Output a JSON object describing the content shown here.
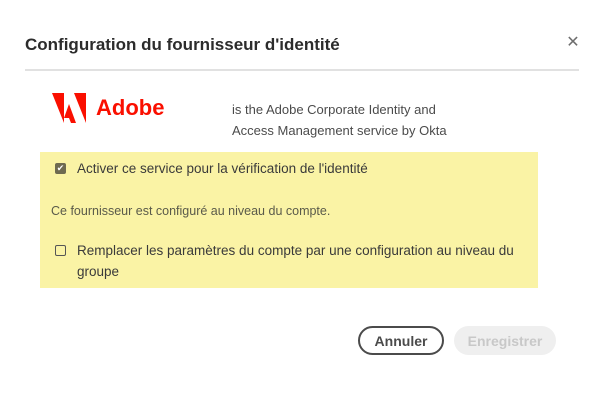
{
  "dialog": {
    "title": "Configuration du fournisseur d'identité",
    "close_icon": "close-icon"
  },
  "provider": {
    "logo_text": "Adobe",
    "brand_color": "#fa0f00",
    "description": "is the Adobe Corporate Identity and Access Management service by Okta"
  },
  "options": {
    "enable_label": "Activer ce service pour la vérification de l'identité",
    "enable_checked": true,
    "note": "Ce fournisseur est configuré au niveau du compte.",
    "override_label": "Remplacer les paramètres du compte par une configuration au niveau du groupe",
    "override_checked": false
  },
  "buttons": {
    "cancel": "Annuler",
    "save": "Enregistrer"
  }
}
